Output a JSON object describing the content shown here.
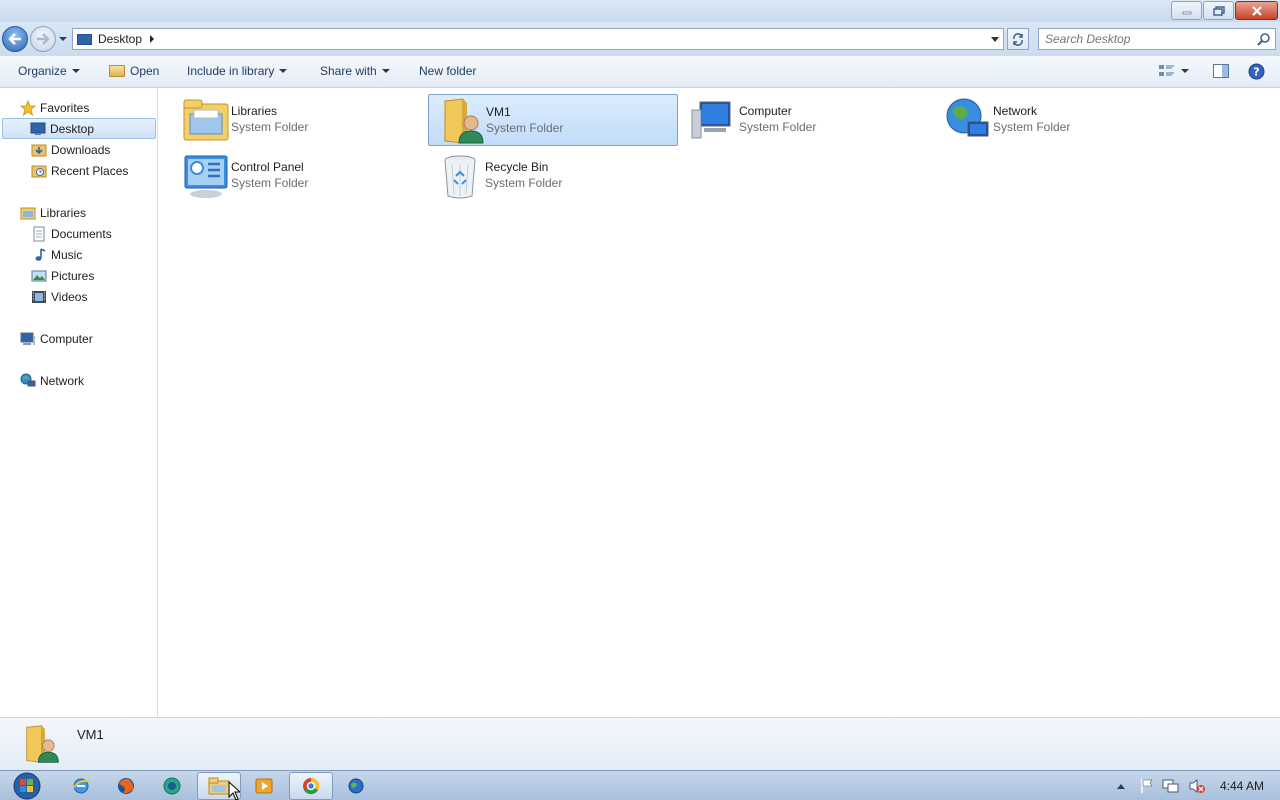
{
  "window": {
    "buttons": {
      "minimize": "minimize-icon",
      "maximize": "restore-icon",
      "close": "close-icon"
    }
  },
  "address": {
    "breadcrumb": [
      "Desktop"
    ],
    "search_placeholder": "Search Desktop"
  },
  "toolbar": {
    "organize": "Organize",
    "open": "Open",
    "include_in_library": "Include in library",
    "share_with": "Share with",
    "new_folder": "New folder"
  },
  "nav": {
    "favorites": "Favorites",
    "desktop": "Desktop",
    "downloads": "Downloads",
    "recent_places": "Recent Places",
    "libraries": "Libraries",
    "documents": "Documents",
    "music": "Music",
    "pictures": "Pictures",
    "videos": "Videos",
    "computer": "Computer",
    "network": "Network"
  },
  "items": [
    {
      "name": "Libraries",
      "type": "System Folder",
      "icon": "libraries-icon"
    },
    {
      "name": "VM1",
      "type": "System Folder",
      "icon": "user-folder-icon",
      "selected": true
    },
    {
      "name": "Computer",
      "type": "System Folder",
      "icon": "computer-icon"
    },
    {
      "name": "Network",
      "type": "System Folder",
      "icon": "network-icon"
    },
    {
      "name": "Control Panel",
      "type": "System Folder",
      "icon": "control-panel-icon"
    },
    {
      "name": "Recycle Bin",
      "type": "System Folder",
      "icon": "recycle-bin-icon"
    }
  ],
  "details": {
    "name": "VM1"
  },
  "taskbar": {
    "apps": [
      "internet-explorer-icon",
      "firefox-icon",
      "messenger-icon",
      "explorer-icon",
      "media-player-icon",
      "chrome-icon",
      "globe-icon"
    ],
    "clock": "4:44 AM"
  },
  "colors": {
    "selection": "#cce4fb",
    "accent": "#2f64a8"
  }
}
